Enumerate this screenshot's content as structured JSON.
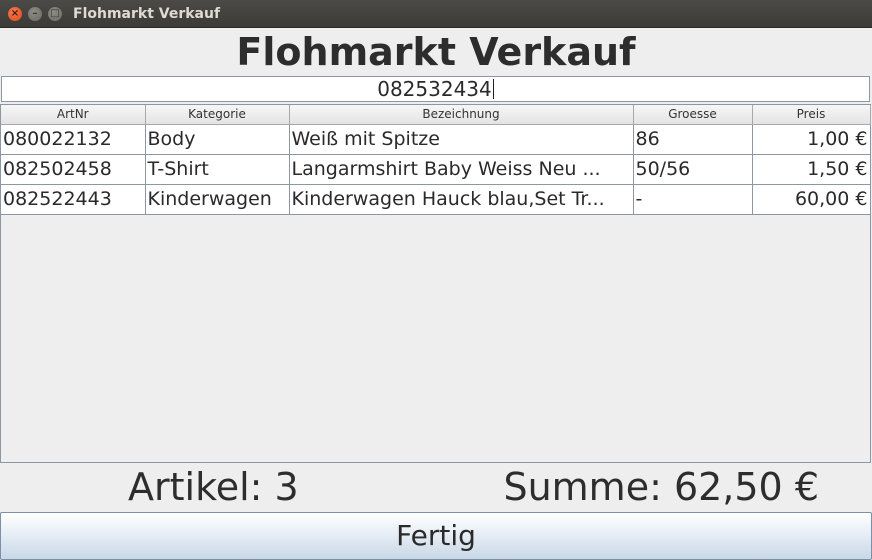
{
  "window": {
    "title": "Flohmarkt Verkauf",
    "controls": {
      "close": "×",
      "minimize": "–",
      "maximize": "□"
    }
  },
  "heading": "Flohmarkt Verkauf",
  "scan": {
    "value": "082532434"
  },
  "table": {
    "columns": [
      "ArtNr",
      "Kategorie",
      "Bezeichnung",
      "Groesse",
      "Preis"
    ],
    "rows": [
      [
        "080022132",
        "Body",
        "Weiß mit Spitze",
        "86",
        "1,00 €"
      ],
      [
        "082502458",
        "T-Shirt",
        "Langarmshirt Baby Weiss Neu ...",
        "50/56",
        "1,50 €"
      ],
      [
        "082522443",
        "Kinderwagen",
        "Kinderwagen Hauck blau,Set Tr...",
        "-",
        "60,00 €"
      ]
    ]
  },
  "summary": {
    "count_text": "Artikel: 3",
    "sum_text": "Summe: 62,50 €"
  },
  "actions": {
    "done_label": "Fertig"
  }
}
